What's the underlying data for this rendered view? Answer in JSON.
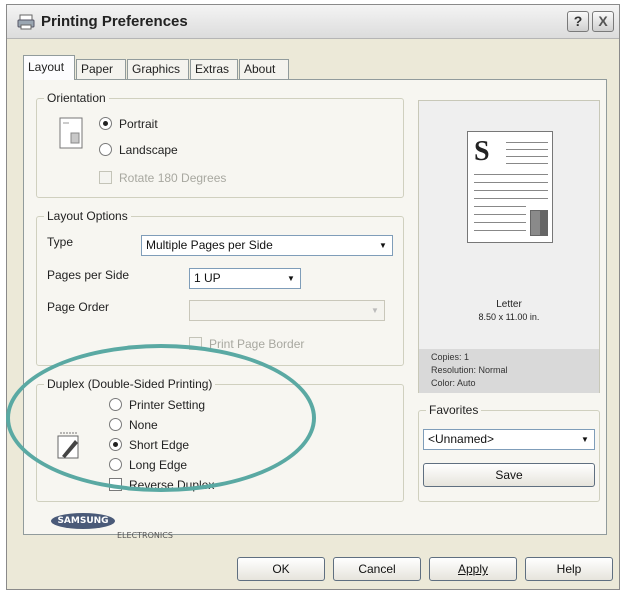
{
  "window": {
    "title": "Printing Preferences",
    "help_button": "?",
    "close_button": "X"
  },
  "tabs": [
    {
      "label": "Layout"
    },
    {
      "label": "Paper"
    },
    {
      "label": "Graphics"
    },
    {
      "label": "Extras"
    },
    {
      "label": "About"
    }
  ],
  "orientation": {
    "legend": "Orientation",
    "portrait_label": "Portrait",
    "landscape_label": "Landscape",
    "rotate_label": "Rotate 180 Degrees",
    "selected": "Portrait"
  },
  "layout_options": {
    "legend": "Layout Options",
    "type_label": "Type",
    "type_value": "Multiple Pages per Side",
    "pages_per_side_label": "Pages per Side",
    "pages_per_side_value": "1 UP",
    "page_order_label": "Page Order",
    "page_order_value": "",
    "print_page_border_label": "Print Page Border"
  },
  "duplex": {
    "legend": "Duplex (Double-Sided Printing)",
    "options": [
      "Printer Setting",
      "None",
      "Short Edge",
      "Long Edge"
    ],
    "selected": "Short Edge",
    "reverse_label": "Reverse Duplex"
  },
  "preview": {
    "letter": "S",
    "paper_name": "Letter",
    "paper_size": "8.50 x 11.00 in.",
    "copies": "Copies: 1",
    "resolution": "Resolution: Normal",
    "color": "Color: Auto"
  },
  "favorites": {
    "legend": "Favorites",
    "value": "<Unnamed>",
    "save_label": "Save"
  },
  "logo": {
    "brand": "SAMSUNG",
    "sub": "ELECTRONICS"
  },
  "buttons": {
    "ok": "OK",
    "cancel": "Cancel",
    "apply": "Apply",
    "help": "Help"
  },
  "colors": {
    "annotation_ellipse": "#5aa9a3",
    "dialog_bg": "#ece9d8"
  }
}
